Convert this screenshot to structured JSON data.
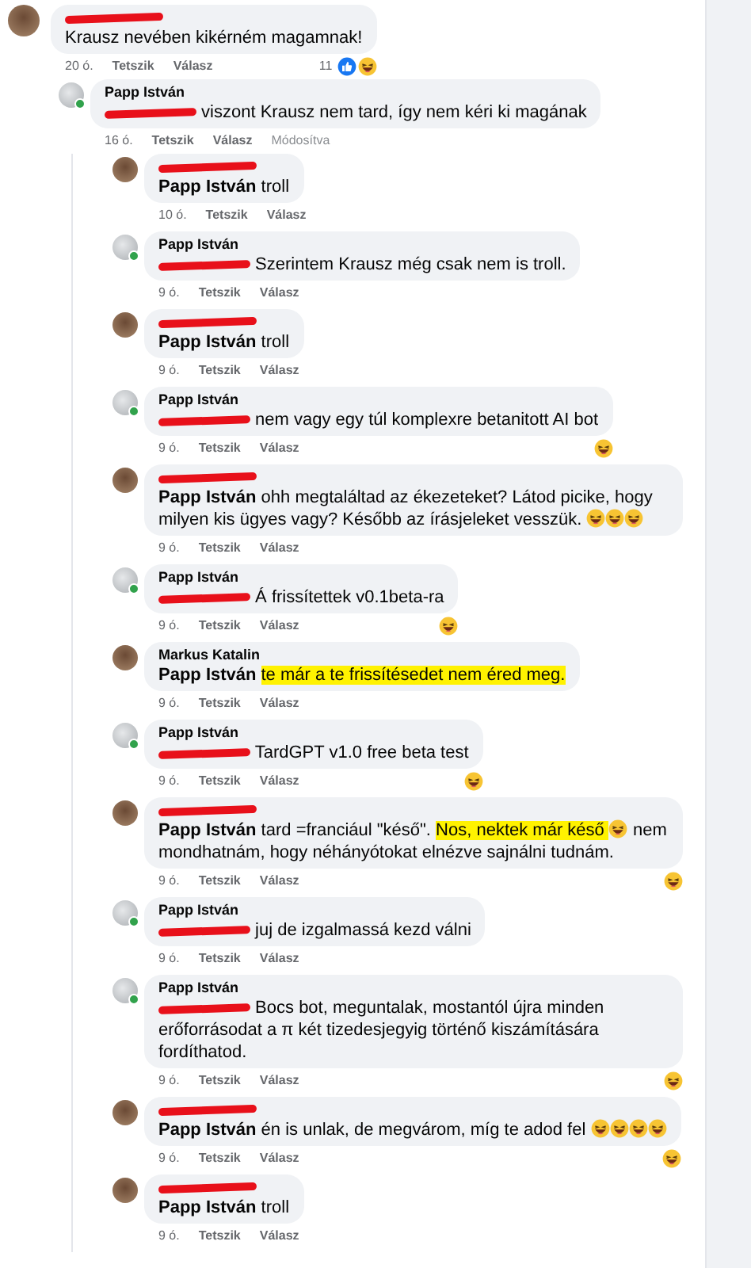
{
  "comments": [
    {
      "author": {
        "redacted": true
      },
      "online": false,
      "body": [
        {
          "kind": "text",
          "text": "Krausz nevében kikérném magamnak!"
        }
      ],
      "time": "20 ó.",
      "like": "Tetszik",
      "reply": "Válasz",
      "reactions": {
        "count": "11",
        "like": true,
        "laugh": true
      },
      "replies": [
        {
          "author": {
            "redacted": false,
            "name": "Papp István"
          },
          "online": true,
          "body": [
            {
              "kind": "redacted"
            },
            {
              "kind": "text",
              "text": " viszont Krausz nem tard, így nem kéri ki magának"
            }
          ],
          "time": "16 ó.",
          "like": "Tetszik",
          "reply": "Válasz",
          "edited": "Módosítva",
          "replies": [
            {
              "author": {
                "redacted": true
              },
              "online": false,
              "body": [
                {
                  "kind": "mention",
                  "text": "Papp István"
                },
                {
                  "kind": "text",
                  "text": " troll"
                }
              ],
              "time": "10 ó.",
              "like": "Tetszik",
              "reply": "Válasz"
            },
            {
              "author": {
                "redacted": false,
                "name": "Papp István"
              },
              "online": true,
              "body": [
                {
                  "kind": "redacted"
                },
                {
                  "kind": "text",
                  "text": " Szerintem Krausz még csak nem is troll."
                }
              ],
              "time": "9 ó.",
              "like": "Tetszik",
              "reply": "Válasz"
            },
            {
              "author": {
                "redacted": true
              },
              "online": false,
              "body": [
                {
                  "kind": "mention",
                  "text": "Papp István"
                },
                {
                  "kind": "text",
                  "text": " troll"
                }
              ],
              "time": "9 ó.",
              "like": "Tetszik",
              "reply": "Válasz"
            },
            {
              "author": {
                "redacted": false,
                "name": "Papp István"
              },
              "online": true,
              "body": [
                {
                  "kind": "redacted"
                },
                {
                  "kind": "text",
                  "text": " nem vagy egy túl komplexre betanitott AI bot"
                }
              ],
              "time": "9 ó.",
              "like": "Tetszik",
              "reply": "Válasz",
              "reactions": {
                "laugh": true
              }
            },
            {
              "author": {
                "redacted": true
              },
              "online": false,
              "body": [
                {
                  "kind": "mention",
                  "text": "Papp István"
                },
                {
                  "kind": "text",
                  "text": " ohh megtaláltad az ékezeteket? Látod picike, hogy milyen kis ügyes vagy? Később az írásjeleket vesszük. "
                },
                {
                  "kind": "emoji"
                },
                {
                  "kind": "emoji"
                },
                {
                  "kind": "emoji"
                }
              ],
              "time": "9 ó.",
              "like": "Tetszik",
              "reply": "Válasz"
            },
            {
              "author": {
                "redacted": false,
                "name": "Papp István"
              },
              "online": true,
              "body": [
                {
                  "kind": "redacted"
                },
                {
                  "kind": "text",
                  "text": " Á frissítettek v0.1beta-ra"
                }
              ],
              "time": "9 ó.",
              "like": "Tetszik",
              "reply": "Válasz",
              "reactions": {
                "laugh": true
              }
            },
            {
              "author": {
                "redacted": false,
                "name": "Markus Katalin"
              },
              "online": false,
              "body": [
                {
                  "kind": "mention",
                  "text": "Papp István"
                },
                {
                  "kind": "highlight",
                  "text": "te már a te frissítésedet nem éred meg."
                }
              ],
              "time": "9 ó.",
              "like": "Tetszik",
              "reply": "Válasz"
            },
            {
              "author": {
                "redacted": false,
                "name": "Papp István"
              },
              "online": true,
              "body": [
                {
                  "kind": "redacted"
                },
                {
                  "kind": "text",
                  "text": " TardGPT v1.0 free beta test"
                }
              ],
              "time": "9 ó.",
              "like": "Tetszik",
              "reply": "Válasz",
              "reactions": {
                "laugh": true
              }
            },
            {
              "author": {
                "redacted": true
              },
              "online": false,
              "body": [
                {
                  "kind": "mention",
                  "text": "Papp István"
                },
                {
                  "kind": "text",
                  "text": " tard =franciául \"késő\". "
                },
                {
                  "kind": "highlight",
                  "text": "Nos, nektek már késő "
                },
                {
                  "kind": "emoji"
                },
                {
                  "kind": "text",
                  "text": " nem mondhatnám, hogy néhányótokat elnézve sajnálni tudnám."
                }
              ],
              "time": "9 ó.",
              "like": "Tetszik",
              "reply": "Válasz",
              "reactions": {
                "laugh": true
              }
            },
            {
              "author": {
                "redacted": false,
                "name": "Papp István"
              },
              "online": true,
              "body": [
                {
                  "kind": "redacted"
                },
                {
                  "kind": "text",
                  "text": " juj de izgalmassá kezd válni"
                }
              ],
              "time": "9 ó.",
              "like": "Tetszik",
              "reply": "Válasz"
            },
            {
              "author": {
                "redacted": false,
                "name": "Papp István"
              },
              "online": true,
              "body": [
                {
                  "kind": "redacted"
                },
                {
                  "kind": "text",
                  "text": " Bocs bot, meguntalak, mostantól újra minden erőforrásodat a π két tizedesjegyig történő kiszámítására fordíthatod."
                }
              ],
              "time": "9 ó.",
              "like": "Tetszik",
              "reply": "Válasz",
              "reactions": {
                "laugh": true
              }
            },
            {
              "author": {
                "redacted": true
              },
              "online": false,
              "body": [
                {
                  "kind": "mention",
                  "text": "Papp István"
                },
                {
                  "kind": "text",
                  "text": " én is unlak, de megvárom, míg te adod fel "
                },
                {
                  "kind": "emoji"
                },
                {
                  "kind": "emoji"
                },
                {
                  "kind": "emoji"
                },
                {
                  "kind": "emoji"
                }
              ],
              "time": "9 ó.",
              "like": "Tetszik",
              "reply": "Válasz",
              "reactions": {
                "laugh": true
              }
            },
            {
              "author": {
                "redacted": true
              },
              "online": false,
              "body": [
                {
                  "kind": "mention",
                  "text": "Papp István"
                },
                {
                  "kind": "text",
                  "text": " troll"
                }
              ],
              "time": "9 ó.",
              "like": "Tetszik",
              "reply": "Válasz"
            }
          ]
        }
      ]
    }
  ]
}
